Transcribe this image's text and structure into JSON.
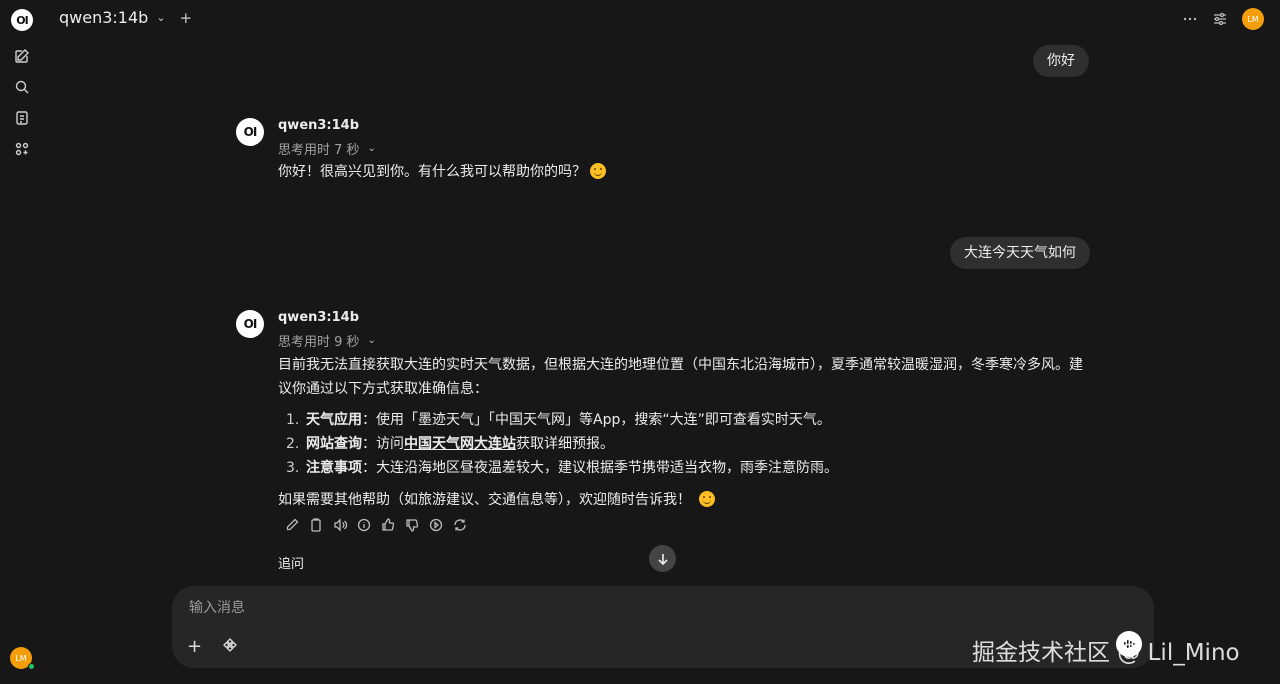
{
  "sidebar": {
    "logo_text": "OI",
    "user_initials": "LM"
  },
  "header": {
    "model_name": "qwen3:14b",
    "user_initials": "LM"
  },
  "messages": [
    {
      "role": "user",
      "text": "你好"
    },
    {
      "role": "assistant",
      "logo_text": "OI",
      "model": "qwen3:14b",
      "thinking": "思考用时 7 秒",
      "text": "你好！很高兴见到你。有什么我可以帮助你的吗？"
    },
    {
      "role": "user",
      "text": "大连今天天气如何"
    },
    {
      "role": "assistant",
      "logo_text": "OI",
      "model": "qwen3:14b",
      "thinking": "思考用时 9 秒",
      "intro": "目前我无法直接获取大连的实时天气数据，但根据大连的地理位置（中国东北沿海城市），夏季通常较温暖湿润，冬季寒冷多风。建议你通过以下方式获取准确信息：",
      "list": [
        {
          "num": "1.",
          "bold": "天气应用",
          "rest": "：使用「墨迹天气」「中国天气网」等App，搜索“大连”即可查看实时天气。"
        },
        {
          "num": "2.",
          "bold": "网站查询",
          "pre": "：访问",
          "link": "中国天气网大连站",
          "rest": "获取详细预报。"
        },
        {
          "num": "3.",
          "bold": "注意事项",
          "rest": "：大连沿海地区昼夜温差较大，建议根据季节携带适当衣物，雨季注意防雨。"
        }
      ],
      "outro": "如果需要其他帮助（如旅游建议、交通信息等），欢迎随时告诉我！"
    }
  ],
  "followup": {
    "title": "追问"
  },
  "input": {
    "placeholder": "输入消息"
  },
  "watermark": "掘金技术社区 @ Lil_Mino",
  "colors": {
    "background": "#171717",
    "bubble": "#2f2f2f",
    "avatar": "#f59e0b"
  }
}
